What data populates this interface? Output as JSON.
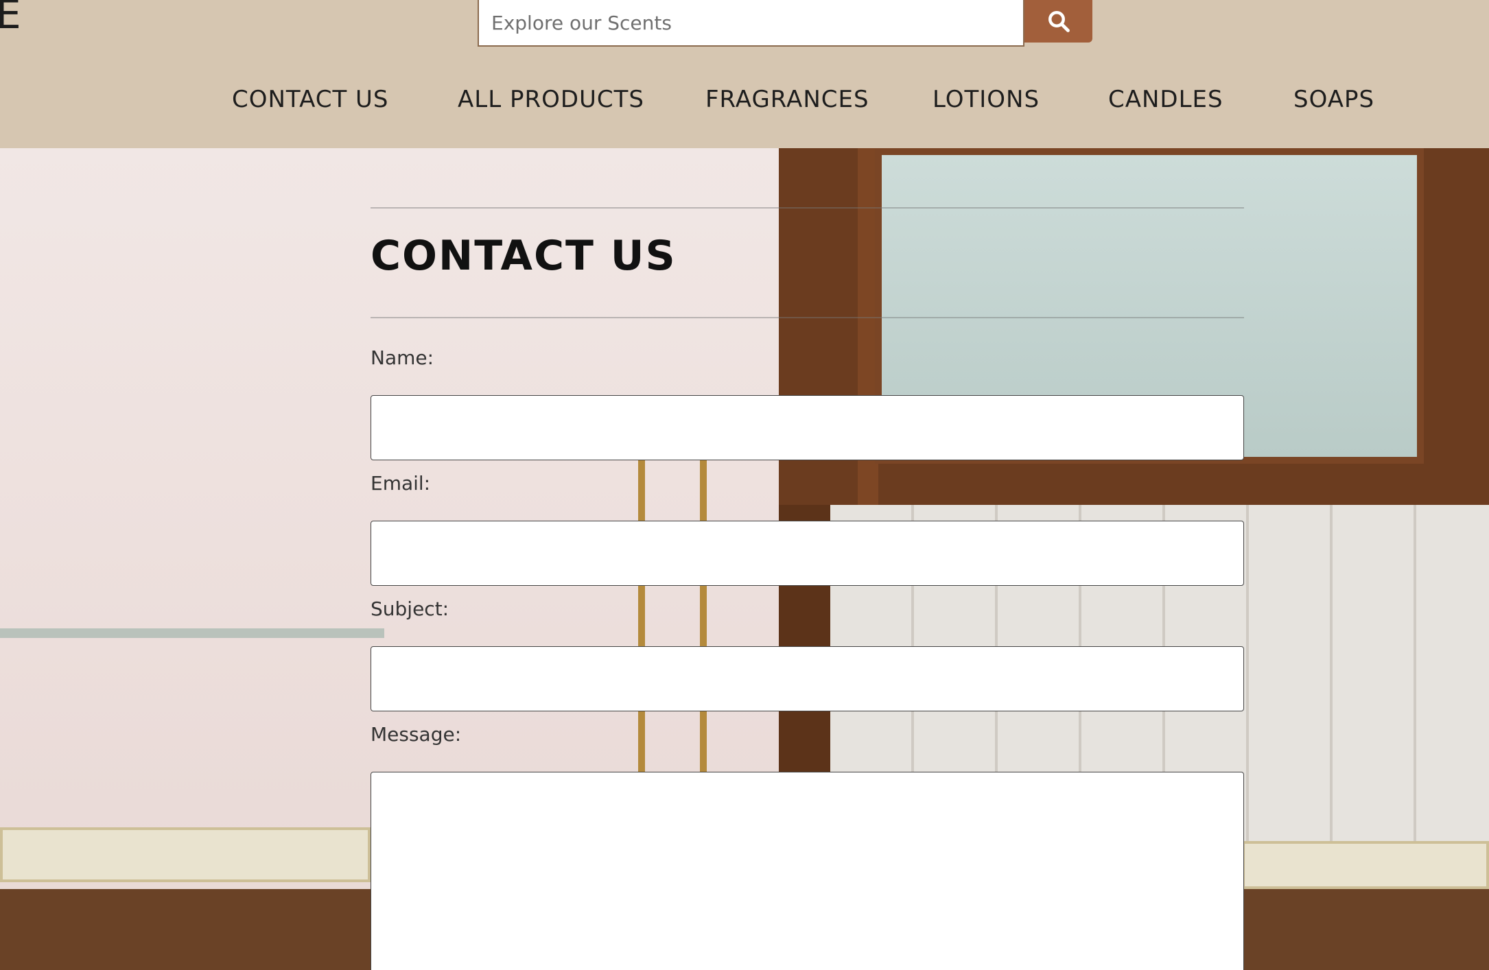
{
  "header": {
    "logo_fragment": "E",
    "search": {
      "placeholder": "Explore our Scents",
      "button_icon": "search-icon"
    },
    "nav": [
      {
        "label": "CONTACT US"
      },
      {
        "label": "ALL PRODUCTS"
      },
      {
        "label": "FRAGRANCES"
      },
      {
        "label": "LOTIONS"
      },
      {
        "label": "CANDLES"
      },
      {
        "label": "SOAPS"
      }
    ]
  },
  "main": {
    "title": "CONTACT US",
    "form": {
      "name_label": "Name:",
      "email_label": "Email:",
      "subject_label": "Subject:",
      "message_label": "Message:"
    }
  },
  "colors": {
    "header_bg": "#d6c6b1",
    "accent": "#a25f3b"
  }
}
